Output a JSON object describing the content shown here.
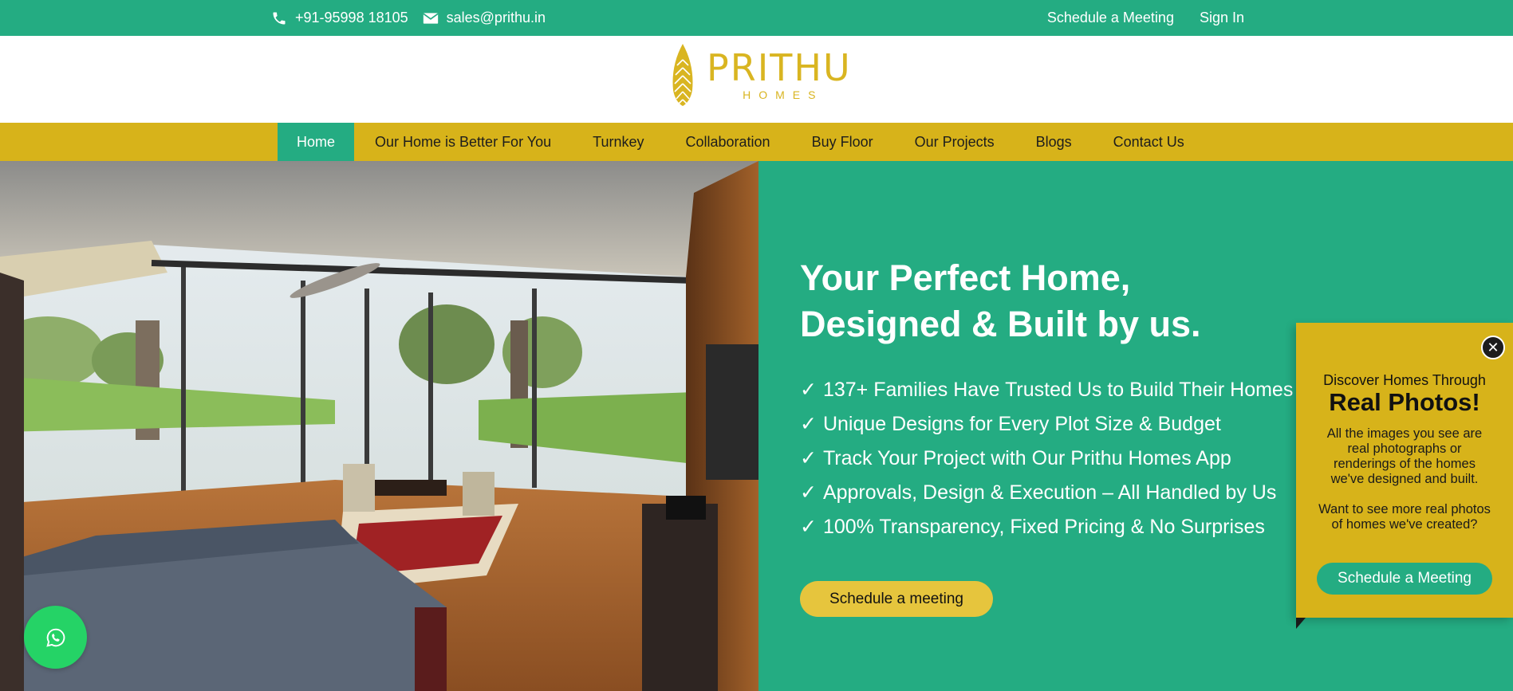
{
  "topbar": {
    "phone": "+91-95998 18105",
    "email": "sales@prithu.in",
    "schedule_link": "Schedule a Meeting",
    "signin_link": "Sign In",
    "phone_icon": "phone-icon",
    "email_icon": "mail-icon"
  },
  "logo": {
    "name": "PRITHU",
    "sub": "HOMES",
    "icon": "leaf-icon"
  },
  "nav": {
    "items": [
      {
        "label": "Home"
      },
      {
        "label": "Our Home is Better For You"
      },
      {
        "label": "Turnkey"
      },
      {
        "label": "Collaboration"
      },
      {
        "label": "Buy Floor"
      },
      {
        "label": "Our Projects"
      },
      {
        "label": "Blogs"
      },
      {
        "label": "Contact Us"
      }
    ],
    "active_index": 0
  },
  "hero": {
    "title_line1": "Your Perfect Home,",
    "title_line2": "Designed & Built by us.",
    "features": [
      "137+ Families Have Trusted Us to Build Their Homes",
      "Unique Designs for Every Plot Size & Budget",
      "Track Your Project with Our Prithu Homes App",
      "Approvals, Design & Execution – All Handled by Us",
      "100% Transparency, Fixed Pricing & No Surprises"
    ],
    "check": "✓",
    "cta": "Schedule a meeting"
  },
  "popup": {
    "line1": "Discover Homes Through",
    "line2": "Real Photos!",
    "para1": "All the images you see are real photographs or renderings of the homes we've designed and built.",
    "para2": "Want to see more real photos of homes we've created?",
    "cta": "Schedule a Meeting",
    "close_icon": "close-icon"
  },
  "whatsapp": {
    "icon": "whatsapp-icon"
  },
  "colors": {
    "green": "#24ac82",
    "gold": "#d7b31a",
    "button_gold": "#e6c53d",
    "logo_gold": "#d9b521"
  }
}
